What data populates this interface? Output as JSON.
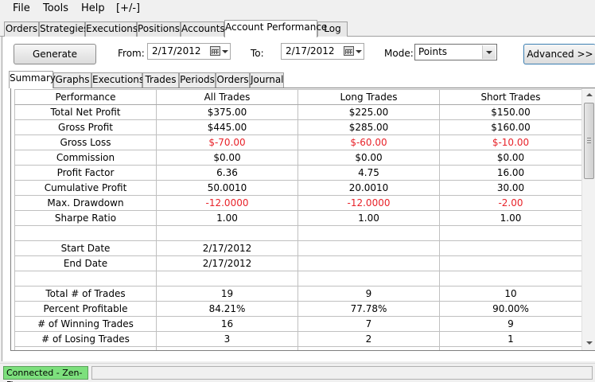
{
  "menu": [
    "File",
    "Tools",
    "Help",
    "[+/-]"
  ],
  "top_tabs": [
    "Orders",
    "Strategies",
    "Executions",
    "Positions",
    "Accounts",
    "Account Performance",
    "Log"
  ],
  "controls": {
    "generate_label": "Generate",
    "from_label": "From:",
    "from_value": "2/17/2012",
    "to_label": "To:",
    "to_value": "2/17/2012",
    "mode_label": "Mode:",
    "mode_value": "Points",
    "advanced_label": "Advanced >>"
  },
  "sub_tabs": [
    "Summary",
    "Graphs",
    "Executions",
    "Trades",
    "Periods",
    "Orders",
    "Journal"
  ],
  "table": {
    "headers": [
      "Performance",
      "All Trades",
      "Long Trades",
      "Short Trades"
    ],
    "rows": [
      [
        "Total Net Profit",
        "$375.00",
        "$225.00",
        "$150.00"
      ],
      [
        "Gross Profit",
        "$445.00",
        "$285.00",
        "$160.00"
      ],
      [
        "Gross Loss",
        "$-70.00",
        "$-60.00",
        "$-10.00"
      ],
      [
        "Commission",
        "$0.00",
        "$0.00",
        "$0.00"
      ],
      [
        "Profit Factor",
        "6.36",
        "4.75",
        "16.00"
      ],
      [
        "Cumulative Profit",
        "50.0010",
        "20.0010",
        "30.00"
      ],
      [
        "Max. Drawdown",
        "-12.0000",
        "-12.0000",
        "-2.00"
      ],
      [
        "Sharpe Ratio",
        "1.00",
        "1.00",
        "1.00"
      ],
      [
        "",
        "",
        "",
        ""
      ],
      [
        "Start Date",
        "2/17/2012",
        "",
        ""
      ],
      [
        "End Date",
        "2/17/2012",
        "",
        ""
      ],
      [
        "",
        "",
        "",
        ""
      ],
      [
        "Total # of Trades",
        "19",
        "9",
        "10"
      ],
      [
        "Percent Profitable",
        "84.21%",
        "77.78%",
        "90.00%"
      ],
      [
        "# of Winning Trades",
        "16",
        "7",
        "9"
      ],
      [
        "# of Losing Trades",
        "3",
        "2",
        "1"
      ],
      [
        "",
        "",
        "",
        ""
      ]
    ],
    "negative_rows": [
      2,
      6
    ],
    "negative_color": "#e8232a"
  },
  "status": {
    "connection": "Connected - Zen-Fire",
    "connection_color": "#7de07d"
  }
}
